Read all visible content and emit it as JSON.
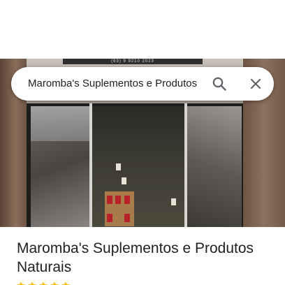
{
  "search": {
    "query": "Maromba's Suplementos e Produtos",
    "search_icon": "search-icon",
    "close_icon": "close-icon"
  },
  "photo": {
    "sign_text": "(63) 9 9210 2023"
  },
  "place": {
    "title": "Maromba's Suplementos e Produtos Naturais"
  },
  "colors": {
    "icon": "#5f6368",
    "text": "#202124",
    "star": "#fbbc04"
  }
}
